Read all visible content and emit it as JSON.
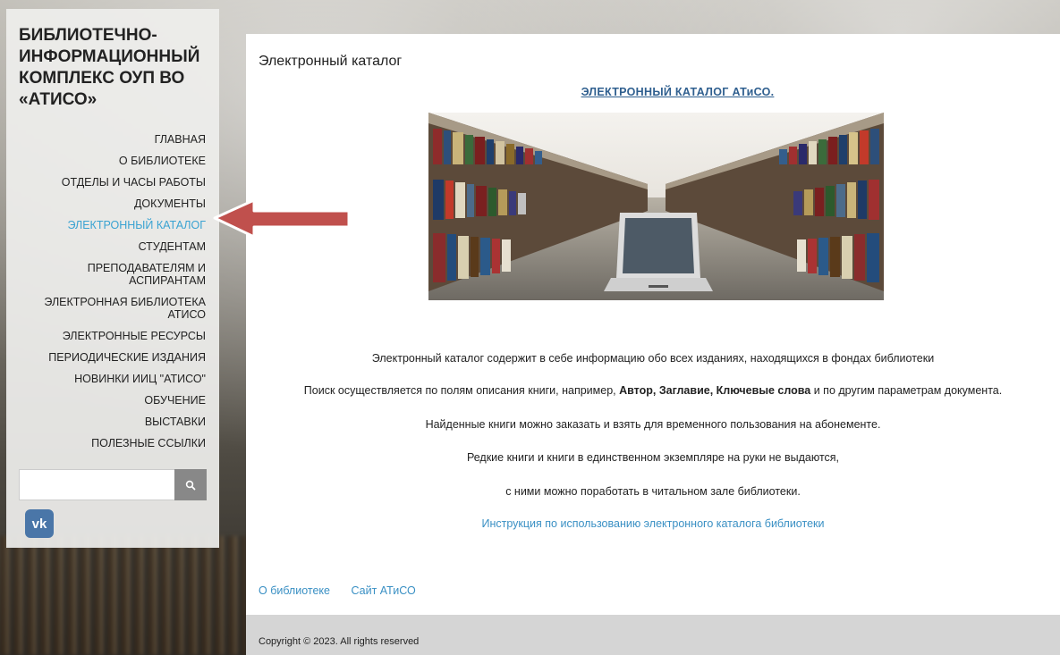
{
  "brand": {
    "title_lines": [
      "БИБЛИОТЕЧНО-",
      "ИНФОРМАЦИОННЫЙ",
      "КОМПЛЕКС ОУП ВО",
      "«АТИСО»"
    ]
  },
  "menu": [
    {
      "label": "ГЛАВНАЯ",
      "lines": [
        "ГЛАВНАЯ"
      ],
      "active": false
    },
    {
      "label": "О БИБЛИОТЕКЕ",
      "lines": [
        "О БИБЛИОТЕКЕ"
      ],
      "active": false
    },
    {
      "label": "ОТДЕЛЫ И ЧАСЫ РАБОТЫ",
      "lines": [
        "ОТДЕЛЫ И ЧАСЫ РАБОТЫ"
      ],
      "active": false
    },
    {
      "label": "ДОКУМЕНТЫ",
      "lines": [
        "ДОКУМЕНТЫ"
      ],
      "active": false
    },
    {
      "label": "ЭЛЕКТРОННЫЙ КАТАЛОГ",
      "lines": [
        "ЭЛЕКТРОННЫЙ КАТАЛОГ"
      ],
      "active": true
    },
    {
      "label": "СТУДЕНТАМ",
      "lines": [
        "СТУДЕНТАМ"
      ],
      "active": false
    },
    {
      "label": "ПРЕПОДАВАТЕЛЯМ И АСПИРАНТАМ",
      "lines": [
        "ПРЕПОДАВАТЕЛЯМ И",
        "АСПИРАНТАМ"
      ],
      "active": false
    },
    {
      "label": "ЭЛЕКТРОННАЯ БИБЛИОТЕКА АТИСО",
      "lines": [
        "ЭЛЕКТРОННАЯ БИБЛИОТЕКА",
        "АТИСО"
      ],
      "active": false
    },
    {
      "label": "ЭЛЕКТРОННЫЕ РЕСУРСЫ",
      "lines": [
        "ЭЛЕКТРОННЫЕ РЕСУРСЫ"
      ],
      "active": false
    },
    {
      "label": "ПЕРИОДИЧЕСКИЕ ИЗДАНИЯ",
      "lines": [
        "ПЕРИОДИЧЕСКИЕ ИЗДАНИЯ"
      ],
      "active": false
    },
    {
      "label": "НОВИНКИ ИИЦ \"АТИСО\"",
      "lines": [
        "НОВИНКИ ИИЦ \"АТИСО\""
      ],
      "active": false
    },
    {
      "label": "ОБУЧЕНИЕ",
      "lines": [
        "ОБУЧЕНИЕ"
      ],
      "active": false
    },
    {
      "label": "ВЫСТАВКИ",
      "lines": [
        "ВЫСТАВКИ"
      ],
      "active": false
    },
    {
      "label": "ПОЛЕЗНЫЕ ССЫЛКИ",
      "lines": [
        "ПОЛЕЗНЫЕ ССЫЛКИ"
      ],
      "active": false
    }
  ],
  "search": {
    "placeholder": "",
    "icon": "search-icon"
  },
  "social": {
    "vk_label": "vk",
    "icon": "vk-icon"
  },
  "main": {
    "title": "Электронный каталог",
    "catalog_link": "ЭЛЕКТРОННЫЙ КАТАЛОГ  АТиСО.",
    "para1": "Электронный каталог содержит в себе информацию обо всех изданиях, находящихся  в фондах  библиотеки",
    "para2_prefix": "Поиск осуществляется по полям описания книги, например, ",
    "para2_bold": "Автор, Заглавие, Ключевые слова",
    "para2_suffix": "  и по другим параметрам документа.",
    "para3": "Найденные книги  можно заказать  и взять для временного пользования на абонементе.",
    "para4": "Редкие книги и книги в  единственном экземпляре на руки не выдаются,",
    "para5": "с ними можно поработать  в читальном зале библиотеки.",
    "instruction_link": "Инструкция по использованию электронного каталога библиотеки"
  },
  "footer": {
    "links": [
      "О библиотеке",
      "Сайт АТиСО"
    ],
    "copyright": "Copyright © 2023. All rights reserved"
  },
  "colors": {
    "active_menu": "#3aa3d2",
    "link": "#3a90c4",
    "arrow": "#c0504d"
  }
}
